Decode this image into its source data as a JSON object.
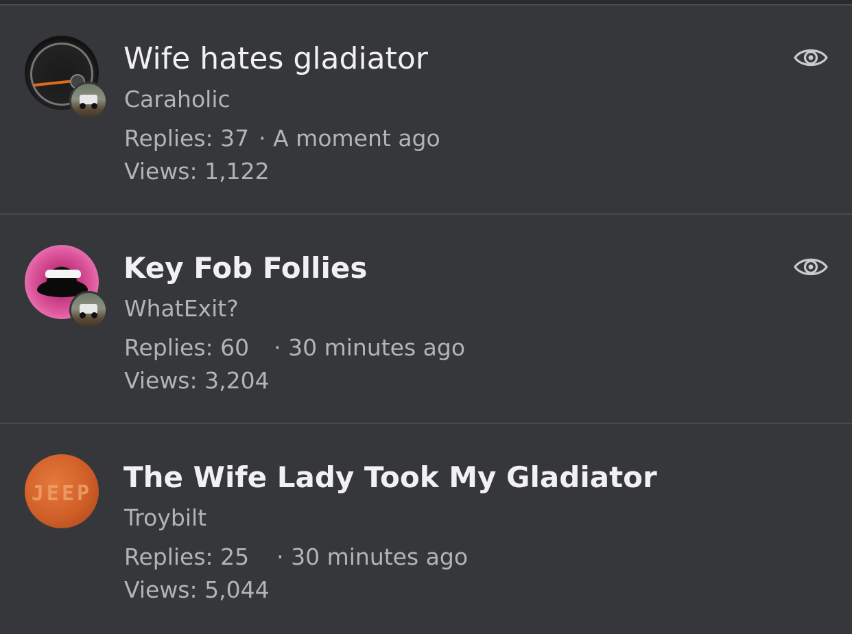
{
  "threads": [
    {
      "title": "Wife hates gladiator",
      "author": "Caraholic",
      "replies": "Replies: 37",
      "time": "· A moment ago",
      "views": "Views: 1,122",
      "unread": false,
      "watched": true
    },
    {
      "title": "Key Fob Follies",
      "author": "WhatExit?",
      "replies": "Replies: 60",
      "time": "· 30 minutes ago",
      "views": "Views: 3,204",
      "unread": true,
      "watched": true
    },
    {
      "title": "The Wife Lady Took My Gladiator",
      "author": "Troybilt",
      "replies": "Replies: 25",
      "time": "· 30 minutes ago",
      "views": "Views: 5,044",
      "unread": true,
      "watched": false,
      "avatar_text": "JEEP"
    }
  ],
  "colors": {
    "background": "#35373b",
    "divider": "#47494d",
    "title_text": "#f1f1f1",
    "secondary_text": "#b2b4b8",
    "icon": "#c9cacd"
  }
}
